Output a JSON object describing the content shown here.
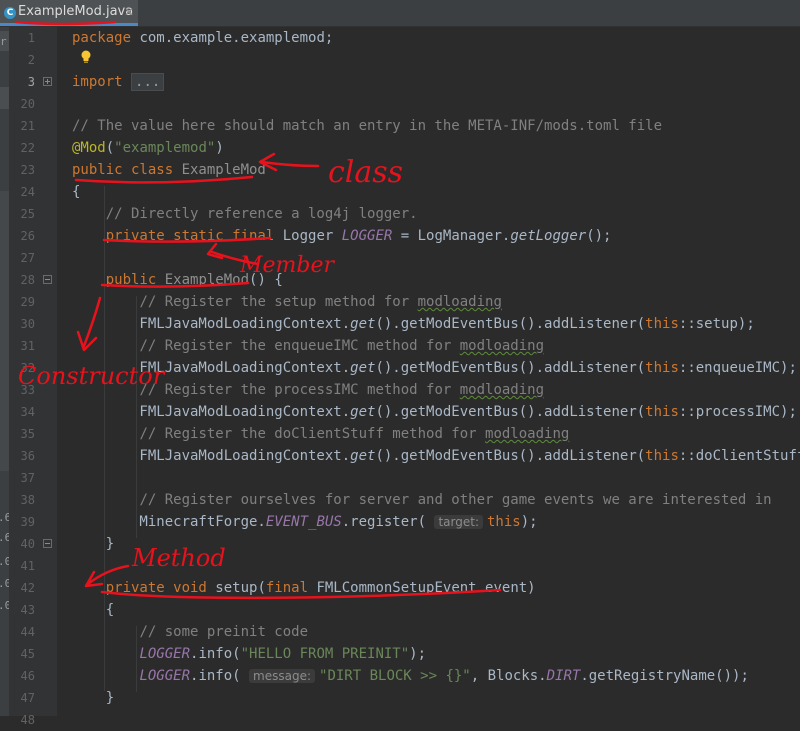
{
  "tab": {
    "label": "ExampleMod.java",
    "icon": "java-class-icon"
  },
  "colors": {
    "keyword": "#cc7832",
    "string": "#6a8759",
    "comment": "#808080",
    "annotation": "#bbb529",
    "field": "#9876aa",
    "text": "#a9b7c6",
    "background": "#2b2b2b",
    "handwriting": "#e8121d"
  },
  "sidebar_fragments": [
    "r",
    ".6",
    ".6",
    ".0",
    ".0",
    ".0"
  ],
  "lines": [
    {
      "no": "1",
      "parts": [
        [
          "kw",
          "package "
        ],
        [
          "",
          "com.example.examplemod;"
        ]
      ]
    },
    {
      "no": "2",
      "parts": []
    },
    {
      "no": "3",
      "parts": [
        [
          "kw",
          "import "
        ],
        [
          "folded",
          "..."
        ]
      ]
    },
    {
      "no": "20",
      "parts": []
    },
    {
      "no": "21",
      "parts": [
        [
          "cm",
          "// The value here should match an entry in the META-INF/mods.toml file"
        ]
      ]
    },
    {
      "no": "22",
      "parts": [
        [
          "ann",
          "@Mod"
        ],
        [
          "",
          "("
        ],
        [
          "str",
          "\"examplemod\""
        ],
        [
          "",
          ")"
        ]
      ]
    },
    {
      "no": "23",
      "parts": [
        [
          "kw",
          "public class "
        ],
        [
          "grey",
          "ExampleMod"
        ]
      ]
    },
    {
      "no": "24",
      "parts": [
        [
          "",
          "{"
        ]
      ]
    },
    {
      "no": "25",
      "parts": [
        [
          "",
          "    "
        ],
        [
          "cm",
          "// Directly reference a log4j logger."
        ]
      ]
    },
    {
      "no": "26",
      "parts": [
        [
          "",
          "    "
        ],
        [
          "kw",
          "private static final "
        ],
        [
          "",
          "Logger "
        ],
        [
          "fld",
          "LOGGER"
        ],
        [
          "",
          " = LogManager."
        ],
        [
          "it",
          "getLogger"
        ],
        [
          "",
          "();"
        ]
      ]
    },
    {
      "no": "27",
      "parts": []
    },
    {
      "no": "28",
      "parts": [
        [
          "",
          "    "
        ],
        [
          "kw",
          "public "
        ],
        [
          "grey",
          "ExampleMod"
        ],
        [
          "",
          "() {"
        ]
      ]
    },
    {
      "no": "29",
      "parts": [
        [
          "",
          "        "
        ],
        [
          "cm",
          "// Register the setup method for "
        ],
        [
          "cm und",
          "modloading"
        ]
      ]
    },
    {
      "no": "30",
      "parts": [
        [
          "",
          "        FMLJavaModLoadingContext."
        ],
        [
          "it",
          "get"
        ],
        [
          "",
          "().getModEventBus().addListener("
        ],
        [
          "kw",
          "this"
        ],
        [
          "",
          "::setup);"
        ]
      ]
    },
    {
      "no": "31",
      "parts": [
        [
          "",
          "        "
        ],
        [
          "cm",
          "// Register the enqueueIMC method for "
        ],
        [
          "cm und",
          "modloading"
        ]
      ]
    },
    {
      "no": "32",
      "parts": [
        [
          "",
          "        FMLJavaModLoadingContext."
        ],
        [
          "it",
          "get"
        ],
        [
          "",
          "().getModEventBus().addListener("
        ],
        [
          "kw",
          "this"
        ],
        [
          "",
          "::enqueueIMC);"
        ]
      ]
    },
    {
      "no": "33",
      "parts": [
        [
          "",
          "        "
        ],
        [
          "cm",
          "// Register the processIMC method for "
        ],
        [
          "cm und",
          "modloading"
        ]
      ]
    },
    {
      "no": "34",
      "parts": [
        [
          "",
          "        FMLJavaModLoadingContext."
        ],
        [
          "it",
          "get"
        ],
        [
          "",
          "().getModEventBus().addListener("
        ],
        [
          "kw",
          "this"
        ],
        [
          "",
          "::processIMC);"
        ]
      ]
    },
    {
      "no": "35",
      "parts": [
        [
          "",
          "        "
        ],
        [
          "cm",
          "// Register the doClientStuff method for "
        ],
        [
          "cm und",
          "modloading"
        ]
      ]
    },
    {
      "no": "36",
      "parts": [
        [
          "",
          "        FMLJavaModLoadingContext."
        ],
        [
          "it",
          "get"
        ],
        [
          "",
          "().getModEventBus().addListener("
        ],
        [
          "kw",
          "this"
        ],
        [
          "",
          "::doClientStuff);"
        ]
      ]
    },
    {
      "no": "37",
      "parts": []
    },
    {
      "no": "38",
      "parts": [
        [
          "",
          "        "
        ],
        [
          "cm",
          "// Register ourselves for server and other game events we are interested in"
        ]
      ]
    },
    {
      "no": "39",
      "parts": [
        [
          "",
          "        MinecraftForge."
        ],
        [
          "fld",
          "EVENT_BUS"
        ],
        [
          "",
          ".register( "
        ],
        [
          "hint",
          "target:"
        ],
        [
          "kw",
          "this"
        ],
        [
          "",
          ");"
        ]
      ]
    },
    {
      "no": "40",
      "parts": [
        [
          "",
          "    }"
        ]
      ]
    },
    {
      "no": "41",
      "parts": []
    },
    {
      "no": "42",
      "parts": [
        [
          "",
          "    "
        ],
        [
          "kw",
          "private void "
        ],
        [
          "",
          "setup("
        ],
        [
          "kw",
          "final "
        ],
        [
          "",
          "FMLCommonSetupEvent event)"
        ]
      ]
    },
    {
      "no": "43",
      "parts": [
        [
          "",
          "    {"
        ]
      ]
    },
    {
      "no": "44",
      "parts": [
        [
          "",
          "        "
        ],
        [
          "cm",
          "// some preinit code"
        ]
      ]
    },
    {
      "no": "45",
      "parts": [
        [
          "",
          "        "
        ],
        [
          "fld",
          "LOGGER"
        ],
        [
          "",
          ".info("
        ],
        [
          "str",
          "\"HELLO FROM PREINIT\""
        ],
        [
          "",
          ");"
        ]
      ]
    },
    {
      "no": "46",
      "parts": [
        [
          "",
          "        "
        ],
        [
          "fld",
          "LOGGER"
        ],
        [
          "",
          ".info( "
        ],
        [
          "hint",
          "message:"
        ],
        [
          "str",
          "\"DIRT BLOCK >> {}\""
        ],
        [
          "",
          ", Blocks."
        ],
        [
          "fld",
          "DIRT"
        ],
        [
          "",
          ".getRegistryName());"
        ]
      ]
    },
    {
      "no": "47",
      "parts": [
        [
          "",
          "    }"
        ]
      ]
    },
    {
      "no": "48",
      "parts": []
    }
  ],
  "annotations": {
    "class": "class",
    "member": "Member",
    "constructor": "Constructor",
    "method": "Method"
  }
}
